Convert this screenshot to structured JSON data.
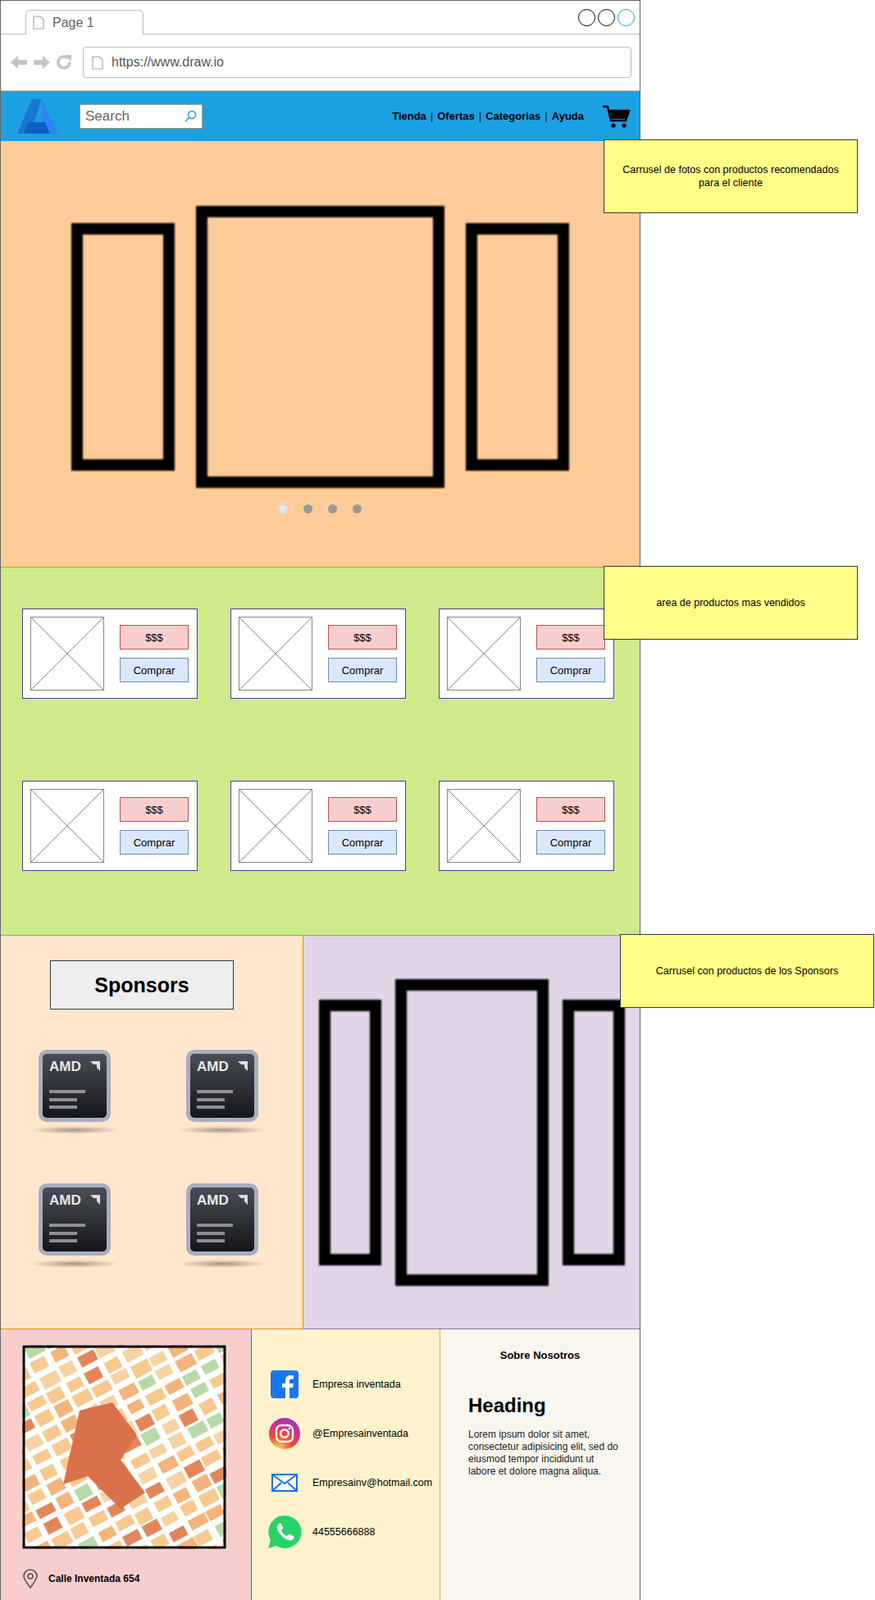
{
  "browser": {
    "tab": "Page 1",
    "url": "https://www.draw.io"
  },
  "navbar": {
    "search_placeholder": "Search",
    "links": [
      "Tienda",
      "Ofertas",
      "Categorias",
      "Ayuda"
    ],
    "separator": "|"
  },
  "hero_carousel": {
    "dots": [
      {
        "selected": true
      },
      {
        "selected": false
      },
      {
        "selected": false
      },
      {
        "selected": false
      }
    ]
  },
  "notes": [
    {
      "text": "Carrusel de fotos con productos recomendados para el cliente"
    },
    {
      "text": "area de productos mas vendidos"
    },
    {
      "text": "Carrusel con productos de los Sponsors"
    }
  ],
  "best_sellers": {
    "products": [
      {
        "price": "$$$",
        "button": "Comprar"
      },
      {
        "price": "$$$",
        "button": "Comprar"
      },
      {
        "price": "$$$",
        "button": "Comprar"
      },
      {
        "price": "$$$",
        "button": "Comprar"
      },
      {
        "price": "$$$",
        "button": "Comprar"
      },
      {
        "price": "$$$",
        "button": "Comprar"
      }
    ]
  },
  "sponsors": {
    "title": "Sponsors",
    "logos": [
      "AMD",
      "AMD",
      "AMD",
      "AMD"
    ]
  },
  "footer": {
    "address": "Calle Inventada 654",
    "contacts": [
      {
        "kind": "facebook",
        "text": "Empresa inventada"
      },
      {
        "kind": "instagram",
        "text": "@Empresainventada"
      },
      {
        "kind": "email",
        "text": "Empresainv@hotmail.com"
      },
      {
        "kind": "whatsapp",
        "text": "44555666888"
      }
    ],
    "about": {
      "title": "Sobre Nosotros",
      "heading": "Heading",
      "body": "Lorem ipsum dolor sit amet, consectetur adipisicing elit, sed do eiusmod tempor incididunt ut labore et dolore magna aliqua."
    }
  }
}
